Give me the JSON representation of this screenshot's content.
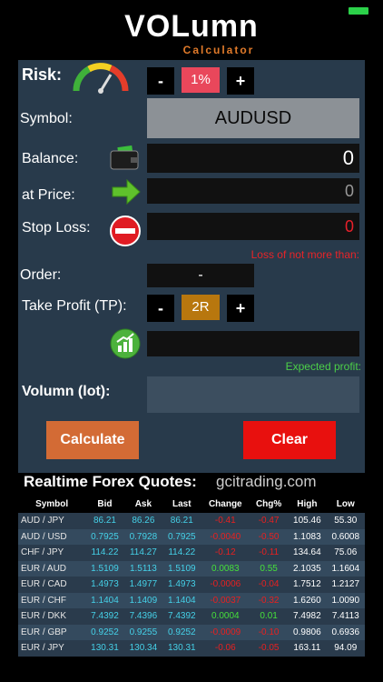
{
  "app": {
    "logo_main": "VOLumn",
    "logo_sub": "Calculator"
  },
  "colors": {
    "accent_orange": "#d36b35",
    "risk_pink": "#e9475b",
    "clear_red": "#e8100e",
    "tp_gold": "#b8770e",
    "panel_bg": "#283a4b"
  },
  "form": {
    "risk_label": "Risk:",
    "risk_minus": "-",
    "risk_value": "1%",
    "risk_plus": "+",
    "symbol_label": "Symbol:",
    "symbol_value": "AUDUSD",
    "balance_label": "Balance:",
    "balance_value": "0",
    "price_label": "at Price:",
    "price_value": "0",
    "stoploss_label": "Stop Loss:",
    "stoploss_value": "0",
    "loss_hint": "Loss of not more than:",
    "order_label": "Order:",
    "order_value": "-",
    "tp_label": "Take Profit (TP):",
    "tp_minus": "-",
    "tp_value": "2R",
    "tp_plus": "+",
    "profit_value": "",
    "profit_hint": "Expected profit:",
    "volumn_label": "Volumn (lot):",
    "volumn_value": "",
    "calculate_label": "Calculate",
    "clear_label": "Clear"
  },
  "quotes": {
    "title": "Realtime  Forex  Quotes:",
    "source": "gcitrading.com",
    "headers": [
      "Symbol",
      "Bid",
      "Ask",
      "Last",
      "Change",
      "Chg%",
      "High",
      "Low"
    ],
    "rows": [
      {
        "symbol": "AUD / JPY",
        "bid": "86.21",
        "ask": "86.26",
        "last": "86.21",
        "change": "-0.41",
        "chg": "-0.47",
        "high": "105.46",
        "low": "55.30",
        "dir": "down"
      },
      {
        "symbol": "AUD / USD",
        "bid": "0.7925",
        "ask": "0.7928",
        "last": "0.7925",
        "change": "-0.0040",
        "chg": "-0.50",
        "high": "1.1083",
        "low": "0.6008",
        "dir": "down"
      },
      {
        "symbol": "CHF / JPY",
        "bid": "114.22",
        "ask": "114.27",
        "last": "114.22",
        "change": "-0.12",
        "chg": "-0.11",
        "high": "134.64",
        "low": "75.06",
        "dir": "down"
      },
      {
        "symbol": "EUR / AUD",
        "bid": "1.5109",
        "ask": "1.5113",
        "last": "1.5109",
        "change": "0.0083",
        "chg": "0.55",
        "high": "2.1035",
        "low": "1.1604",
        "dir": "up"
      },
      {
        "symbol": "EUR / CAD",
        "bid": "1.4973",
        "ask": "1.4977",
        "last": "1.4973",
        "change": "-0.0006",
        "chg": "-0.04",
        "high": "1.7512",
        "low": "1.2127",
        "dir": "down"
      },
      {
        "symbol": "EUR / CHF",
        "bid": "1.1404",
        "ask": "1.1409",
        "last": "1.1404",
        "change": "-0.0037",
        "chg": "-0.32",
        "high": "1.6260",
        "low": "1.0090",
        "dir": "down"
      },
      {
        "symbol": "EUR / DKK",
        "bid": "7.4392",
        "ask": "7.4396",
        "last": "7.4392",
        "change": "0.0004",
        "chg": "0.01",
        "high": "7.4982",
        "low": "7.4113",
        "dir": "up"
      },
      {
        "symbol": "EUR / GBP",
        "bid": "0.9252",
        "ask": "0.9255",
        "last": "0.9252",
        "change": "-0.0009",
        "chg": "-0.10",
        "high": "0.9806",
        "low": "0.6936",
        "dir": "down"
      },
      {
        "symbol": "EUR / JPY",
        "bid": "130.31",
        "ask": "130.34",
        "last": "130.31",
        "change": "-0.06",
        "chg": "-0.05",
        "high": "163.11",
        "low": "94.09",
        "dir": "down"
      }
    ]
  },
  "icons": {
    "risk": "speedometer-gauge-icon",
    "balance": "wallet-icon",
    "price": "green-arrow-right-icon",
    "stoploss": "no-entry-icon",
    "profit": "bar-chart-growth-icon"
  },
  "status": {
    "battery": "battery-icon"
  }
}
